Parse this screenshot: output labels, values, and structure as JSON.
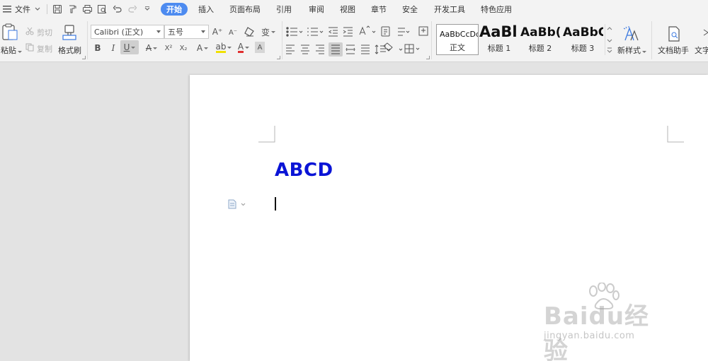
{
  "menubar": {
    "hamburger_icon": "menu-icon",
    "file_label": "文件",
    "quick_access_icons": [
      "save-icon",
      "format-painter-small-icon",
      "print-icon",
      "print-preview-icon",
      "undo-icon",
      "redo-icon",
      "customize-icon"
    ],
    "tabs": [
      {
        "label": "开始",
        "active": true
      },
      {
        "label": "插入",
        "active": false
      },
      {
        "label": "页面布局",
        "active": false
      },
      {
        "label": "引用",
        "active": false
      },
      {
        "label": "审阅",
        "active": false
      },
      {
        "label": "视图",
        "active": false
      },
      {
        "label": "章节",
        "active": false
      },
      {
        "label": "安全",
        "active": false
      },
      {
        "label": "开发工具",
        "active": false
      },
      {
        "label": "特色应用",
        "active": false
      }
    ]
  },
  "ribbon": {
    "clipboard": {
      "paste_label": "粘贴",
      "cut_label": "剪切",
      "copy_label": "复制",
      "format_painter_label": "格式刷"
    },
    "font": {
      "font_name": "Calibri (正文)",
      "font_size": "五号",
      "bold": "B",
      "italic": "I",
      "underline": "U",
      "strikethrough": "A",
      "superscript": "X²",
      "subscript": "X₂",
      "text_effect": "A",
      "highlight": "ab",
      "font_color": "A",
      "char_shading": "A",
      "grow": "A⁺",
      "shrink": "A⁻",
      "clear": "clear-format-icon",
      "phonetic": "变"
    },
    "styles": {
      "items": [
        {
          "sample": "AaBbCcDd",
          "name": "正文",
          "selected": true
        },
        {
          "sample": "AaBl",
          "name": "标题 1",
          "selected": false
        },
        {
          "sample": "AaBb(",
          "name": "标题 2",
          "selected": false
        },
        {
          "sample": "AaBbC",
          "name": "标题 3",
          "selected": false
        }
      ],
      "new_style_label": "新样式",
      "doc_assistant_label": "文档助手",
      "text_tools_label": "文字"
    }
  },
  "document": {
    "heading_text": "ABCD",
    "heading_color": "#0a14d6"
  },
  "colors": {
    "accent": "#4d8bf0",
    "ribbon_bg": "#f3f3f3",
    "workspace_bg": "#e3e3e3",
    "font_color_bar": "#e03030",
    "highlight_bar": "#f0e000"
  },
  "watermark": {
    "brand": "Baidu经验",
    "site": "jingyan.baidu.com"
  }
}
